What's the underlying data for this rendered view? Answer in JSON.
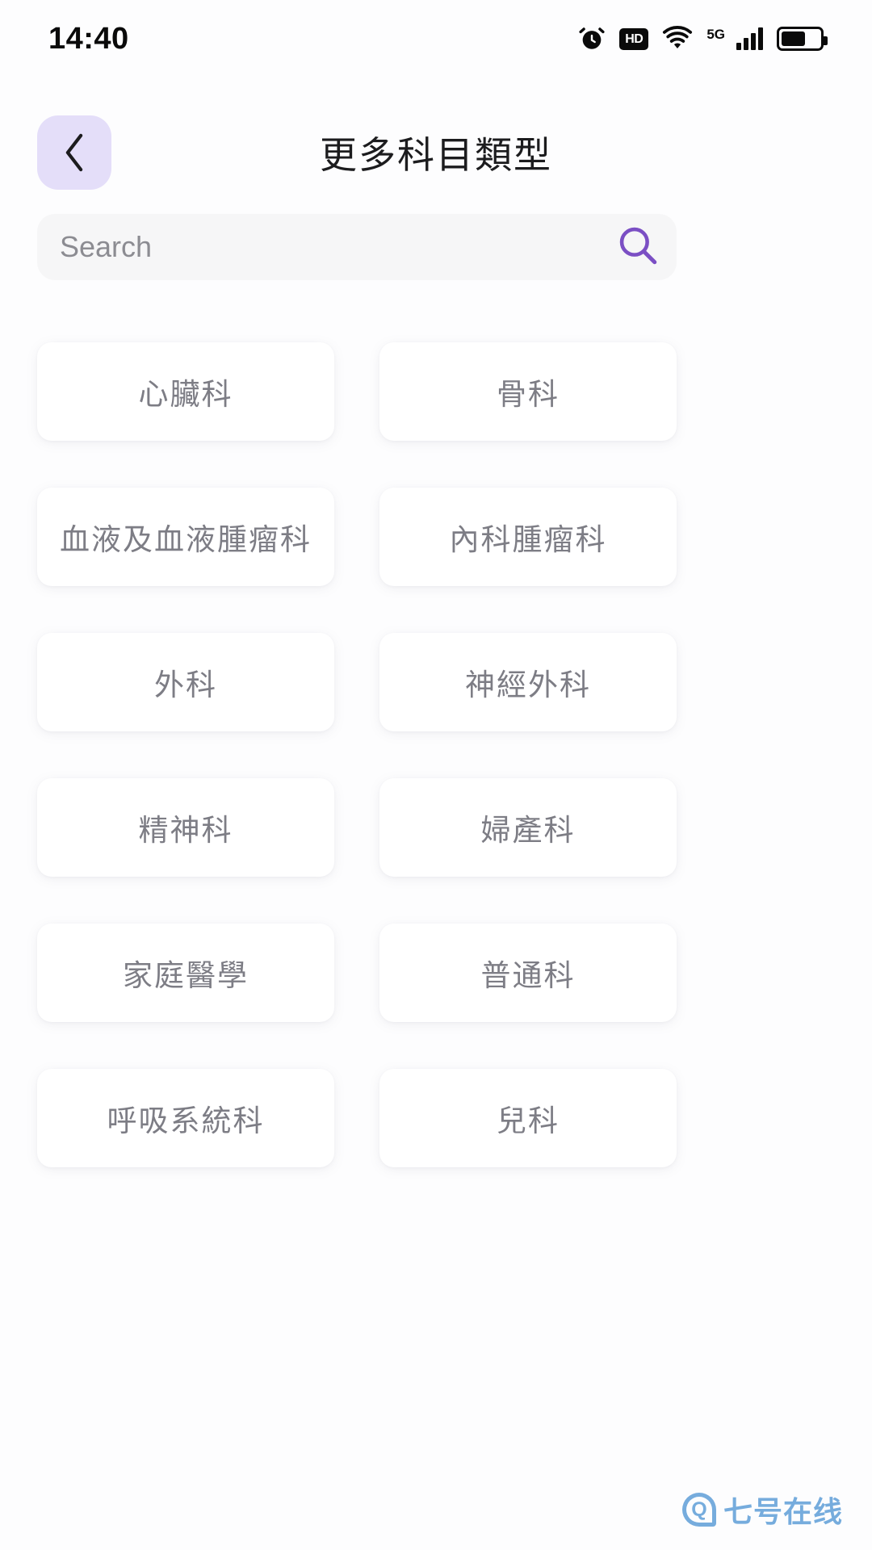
{
  "status_bar": {
    "time": "14:40",
    "icons": [
      {
        "name": "alarm-icon",
        "label": "alarm"
      },
      {
        "name": "hd-icon",
        "label": "HD"
      },
      {
        "name": "wifi-icon",
        "label": "wifi"
      },
      {
        "name": "network-5g-icon",
        "label": "5G"
      },
      {
        "name": "signal-bars-icon",
        "label": "signal"
      },
      {
        "name": "battery-icon",
        "label": "battery"
      }
    ]
  },
  "header": {
    "title": "更多科目類型",
    "back_icon": "chevron-left-icon",
    "back_bg_color": "#E4DEF9"
  },
  "search": {
    "value": "",
    "placeholder": "Search",
    "icon": "search-icon",
    "icon_color": "#7B4FC4",
    "bg_color": "#F6F6F7"
  },
  "grid": {
    "text_color": "#7D7D85",
    "card_color": "#FFFFFF",
    "items": [
      {
        "label": "心臟科"
      },
      {
        "label": "骨科"
      },
      {
        "label": "血液及血液腫瘤科"
      },
      {
        "label": "內科腫瘤科"
      },
      {
        "label": "外科"
      },
      {
        "label": "神經外科"
      },
      {
        "label": "精神科"
      },
      {
        "label": "婦產科"
      },
      {
        "label": "家庭醫學"
      },
      {
        "label": "普通科"
      },
      {
        "label": "呼吸系統科"
      },
      {
        "label": "兒科"
      }
    ]
  },
  "watermark": {
    "text": "七号在线",
    "mark": "Q",
    "color": "#6FA8DC"
  }
}
